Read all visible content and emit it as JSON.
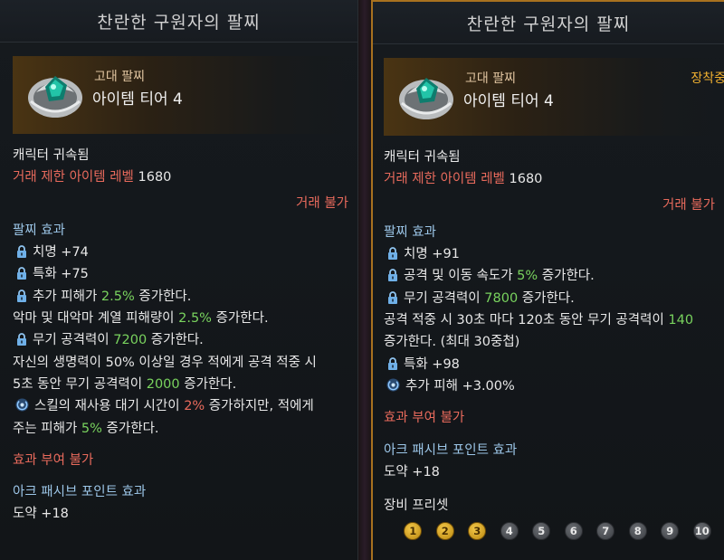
{
  "left": {
    "title": "찬란한 구원자의 팔찌",
    "grade": "고대 팔찌",
    "tier": "아이템 티어 4",
    "bound": "캐릭터 귀속됨",
    "trade_level_label": "거래 제한 아이템 레벨",
    "trade_level_value": "1680",
    "trade_status": "거래 불가",
    "effect_header": "팔찌 효과",
    "effects": {
      "crit": "치명 +74",
      "spec": "특화 +75",
      "extra_dmg_a": "추가 피해가 ",
      "extra_dmg_pct": "2.5%",
      "extra_dmg_b": " 증가한다.",
      "demon_a": "악마 및 대악마 계열 피해량이 ",
      "demon_pct": "2.5%",
      "demon_b": " 증가한다.",
      "weapon_a": "무기 공격력이 ",
      "weapon_val": "7200",
      "weapon_b": " 증가한다.",
      "hp_line1": "자신의 생명력이 50% 이상일 경우 적에게 공격 적중 시",
      "hp_line2_a": "5초 동안 무기 공격력이 ",
      "hp_line2_val": "2000",
      "hp_line2_b": " 증가한다.",
      "cd_a": "스킬의 재사용 대기 시간이 ",
      "cd_pct": "2%",
      "cd_b": " 증가하지만, 적에게",
      "cd2_a": "주는 피해가 ",
      "cd2_pct": "5%",
      "cd2_b": " 증가한다."
    },
    "no_enchant": "효과 부여 불가",
    "ark_header": "아크 패시브 포인트 효과",
    "ark_value": "도약 +18"
  },
  "right": {
    "title": "찬란한 구원자의 팔찌",
    "grade": "고대 팔찌",
    "tier": "아이템 티어 4",
    "equipped": "장착중",
    "bound": "캐릭터 귀속됨",
    "trade_level_label": "거래 제한 아이템 레벨",
    "trade_level_value": "1680",
    "trade_status": "거래 불가",
    "effect_header": "팔찌 효과",
    "effects": {
      "crit": "치명 +91",
      "speed_a": "공격 및 이동 속도가 ",
      "speed_pct": "5%",
      "speed_b": " 증가한다.",
      "weapon_a": "무기 공격력이 ",
      "weapon_val": "7800",
      "weapon_b": " 증가한다.",
      "hit_a": "공격 적중 시 30초 마다 120초 동안 무기 공격력이 ",
      "hit_val": "140",
      "hit_line2": "증가한다. (최대 30중첩)",
      "spec": "특화 +98",
      "extra_dmg": "추가 피해 +3.00%"
    },
    "no_enchant": "효과 부여 불가",
    "ark_header": "아크 패시브 포인트 효과",
    "ark_value": "도약 +18",
    "preset_label": "장비 프리셋",
    "presets": [
      {
        "n": "1",
        "active": true
      },
      {
        "n": "2",
        "active": true
      },
      {
        "n": "3",
        "active": true
      },
      {
        "n": "4",
        "active": false
      },
      {
        "n": "5",
        "active": false
      },
      {
        "n": "6",
        "active": false
      },
      {
        "n": "7",
        "active": false
      },
      {
        "n": "8",
        "active": false
      },
      {
        "n": "9",
        "active": false
      },
      {
        "n": "10",
        "active": false
      }
    ]
  },
  "icons": {
    "lock": "lock-icon",
    "swirl": "swirl-icon",
    "item": "bracelet-icon"
  },
  "colors": {
    "accent_gold": "#f0b030",
    "restricted_red": "#e86a5c",
    "value_green": "#79d35e",
    "section_blue": "#9cc6e8"
  }
}
